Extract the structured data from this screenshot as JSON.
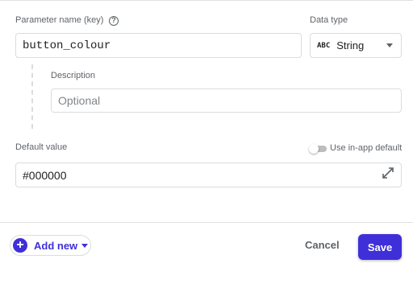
{
  "form": {
    "param_name_label": "Parameter name (key)",
    "param_name_value": "button_colour",
    "help_icon": "help-circle-icon",
    "data_type_label": "Data type",
    "data_type_icon_text": "ABC",
    "data_type_value": "String",
    "description_label": "Description",
    "description_placeholder": "Optional",
    "default_value_label": "Default value",
    "use_in_app_default_label": "Use in-app default",
    "use_in_app_default_on": false,
    "default_value": "#000000",
    "expand_icon": "expand-diagonal-icon"
  },
  "footer": {
    "add_new_label": "Add new",
    "cancel_label": "Cancel",
    "save_label": "Save"
  },
  "colors": {
    "accent": "#3f2fd9",
    "border": "#dadce0"
  }
}
